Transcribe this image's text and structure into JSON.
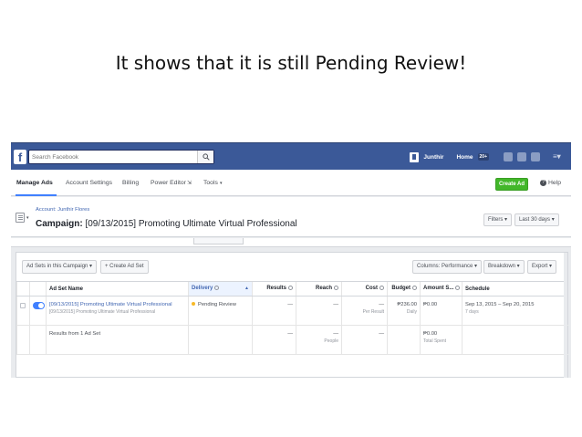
{
  "slide": {
    "title": "It shows that it is still Pending Review!"
  },
  "fb": {
    "search_placeholder": "Search Facebook",
    "user_name": "Junthir",
    "home_label": "Home",
    "home_count": "20+"
  },
  "nav": {
    "items": [
      "Manage Ads",
      "Account Settings",
      "Billing",
      "Power Editor",
      "Tools"
    ],
    "create_ad": "Create Ad",
    "help": "Help"
  },
  "campaign": {
    "account_line": "Account: Junthir Flores",
    "label": "Campaign:",
    "name": "[09/13/2015] Promoting Ultimate Virtual Professional",
    "filters": "Filters ▾",
    "date_range": "Last 30 days ▾"
  },
  "toolbar": {
    "adsets_filter": "Ad Sets in this Campaign ▾",
    "create_adset": "+ Create Ad Set",
    "columns": "Columns: Performance ▾",
    "breakdown": "Breakdown ▾",
    "export": "Export ▾"
  },
  "table": {
    "headers": [
      "Ad Set Name",
      "Delivery",
      "Results",
      "Reach",
      "Cost",
      "Budget",
      "Amount S...",
      "Schedule"
    ],
    "row1": {
      "name": "[09/13/2015] Promoting Ultimate Virtual Professional",
      "sub_name": "[09/13/2015] Promoting Ultimate Virtual Professional",
      "delivery": "Pending Review",
      "results": "—",
      "reach": "—",
      "cost": "—",
      "cost_sub": "Per Result",
      "budget": "₱236.00",
      "budget_sub": "Daily",
      "amount": "₱0.00",
      "schedule": "Sep 13, 2015 – Sep 20, 2015",
      "schedule_sub": "7 days"
    },
    "row2": {
      "name": "Results from 1 Ad Set",
      "results": "—",
      "reach": "—",
      "reach_sub": "People",
      "cost": "—",
      "amount": "₱0.00",
      "amount_sub": "Total Spent"
    }
  },
  "colors": {
    "fb_blue": "#3b5998",
    "create_green": "#42b72a",
    "toggle_blue": "#4080ff",
    "pending": "#f7b928"
  }
}
